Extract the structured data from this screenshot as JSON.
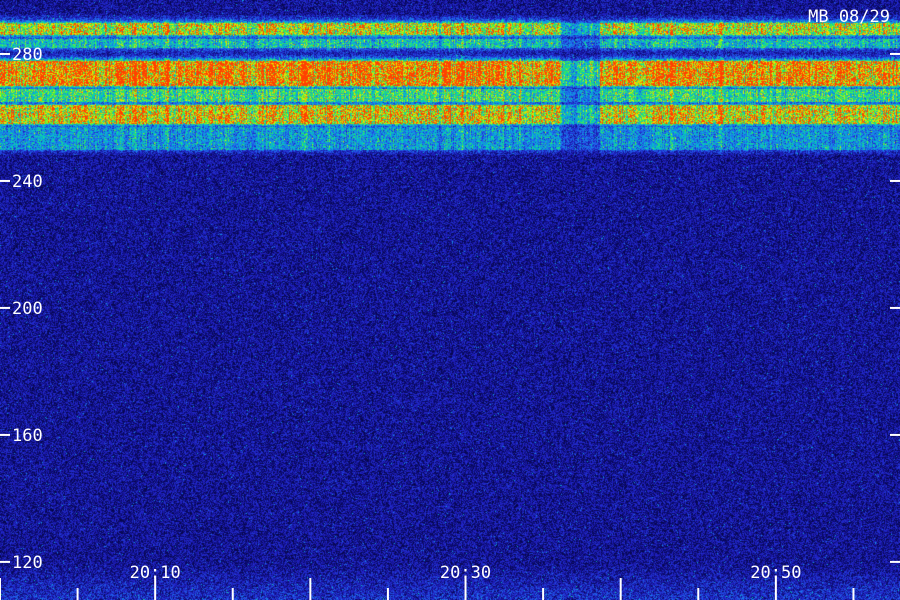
{
  "chart_data": {
    "type": "heatmap",
    "title": "MB 08/29",
    "xlabel": "",
    "ylabel": "",
    "x_ticks": [
      "20:10",
      "20:30",
      "20:50"
    ],
    "y_ticks": [
      120,
      160,
      200,
      240,
      280
    ],
    "xlim": [
      "20:00",
      "20:58"
    ],
    "ylim": [
      108,
      297
    ],
    "x_minor_step_minutes": 5,
    "colormap": [
      "#000010",
      "#0a0a6a",
      "#2222c8",
      "#1f6ff0",
      "#00c8c8",
      "#40f040",
      "#f0f000",
      "#ff4000"
    ],
    "grid": false,
    "legend": "none",
    "bands": [
      {
        "y_from": 286,
        "y_to": 290,
        "intensity": 0.75
      },
      {
        "y_from": 282,
        "y_to": 285,
        "intensity": 0.45
      },
      {
        "y_from": 270,
        "y_to": 278,
        "intensity": 0.95
      },
      {
        "y_from": 265,
        "y_to": 269,
        "intensity": 0.55
      },
      {
        "y_from": 258,
        "y_to": 264,
        "intensity": 0.8
      },
      {
        "y_from": 250,
        "y_to": 257,
        "intensity": 0.35
      }
    ],
    "noise_floor": 0.22
  }
}
